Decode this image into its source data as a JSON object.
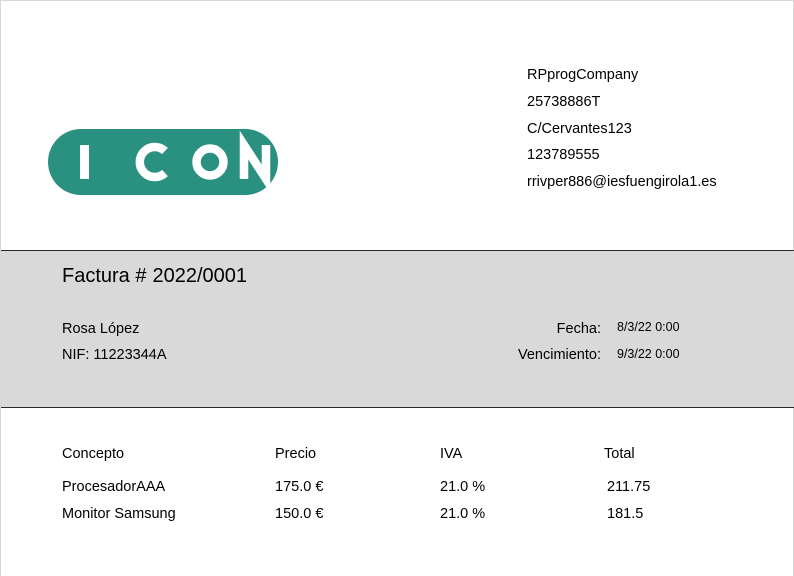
{
  "logo": {
    "text": "ICON",
    "color": "#2a9080"
  },
  "company": {
    "name": "RPprogCompany",
    "tax_id": "25738886T",
    "address": "C/Cervantes123",
    "phone": "123789555",
    "email": "rrivper886@iesfuengirola1.es"
  },
  "invoice": {
    "title_label": "Factura #",
    "number": "2022/0001",
    "client_name": "Rosa López",
    "nif_label": "NIF:",
    "nif_value": "11223344A",
    "fecha_label": "Fecha:",
    "fecha_value": "8/3/22 0:00",
    "vencimiento_label": "Vencimiento:",
    "vencimiento_value": "9/3/22 0:00"
  },
  "table": {
    "headers": [
      "Concepto",
      "Precio",
      "IVA",
      "Total"
    ],
    "rows": [
      [
        "ProcesadorAAA",
        "175.0 €",
        "21.0 %",
        "211.75"
      ],
      [
        "Monitor Samsung",
        "150.0 €",
        "21.0 %",
        "181.5"
      ]
    ]
  },
  "colors": {
    "band_background": "#d9d9d9",
    "logo_teal": "#2a9080"
  }
}
